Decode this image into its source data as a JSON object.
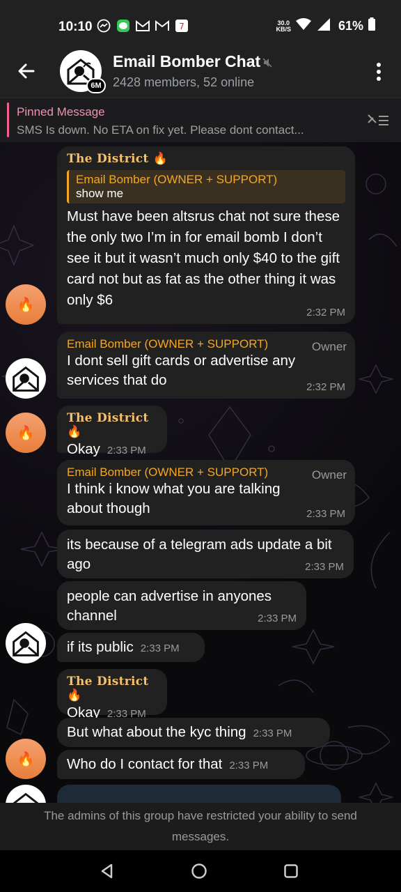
{
  "status_bar": {
    "time": "10:10",
    "net_speed_value": "30.0",
    "net_speed_unit": "KB/S",
    "battery": "61%"
  },
  "header": {
    "title": "Email Bomber Chat",
    "subtitle": "2428 members, 52 online",
    "avatar_badge": "6M"
  },
  "pinned": {
    "title": "Pinned Message",
    "text": "SMS Is down. No ETA on fix yet. Please dont contact..."
  },
  "messages": [
    {
      "sender": "The District 🔥",
      "reply_name": "Email Bomber (OWNER + SUPPORT)",
      "reply_text": "show me",
      "text": "Must have been altsrus chat not sure these the only two I’m in for email bomb I don’t see it but it wasn’t much only $40 to the gift card not but as fat as the other thing it was only $6",
      "time": "2:32 PM"
    },
    {
      "sender": "Email Bomber (OWNER + SUPPORT)",
      "tag": "Owner",
      "text": "I dont sell gift cards or advertise any services that do",
      "time": "2:32 PM"
    },
    {
      "sender": "The District 🔥",
      "text": "Okay",
      "time": "2:33 PM"
    },
    {
      "sender": "Email Bomber (OWNER + SUPPORT)",
      "tag": "Owner",
      "text": "I think i know what you are talking about though",
      "time": "2:33 PM"
    },
    {
      "text": "its because of a telegram ads update a bit ago",
      "time": "2:33 PM"
    },
    {
      "text": "people can advertise in anyones channel",
      "time": "2:33 PM"
    },
    {
      "text": "if its public",
      "time": "2:33 PM"
    },
    {
      "sender": "The District 🔥",
      "text": "Okay",
      "time": "2:33 PM"
    },
    {
      "text": "But what about the kyc thing",
      "time": "2:33 PM"
    },
    {
      "text": "Who do I contact for that",
      "time": "2:33 PM"
    }
  ],
  "restriction_notice": "The admins of this group have restricted your ability to send messages.",
  "colors": {
    "accent_orange": "#f5a623",
    "pinned_pink": "#f48fb1",
    "bubble_bg": "#212121",
    "header_bg": "#212121"
  }
}
